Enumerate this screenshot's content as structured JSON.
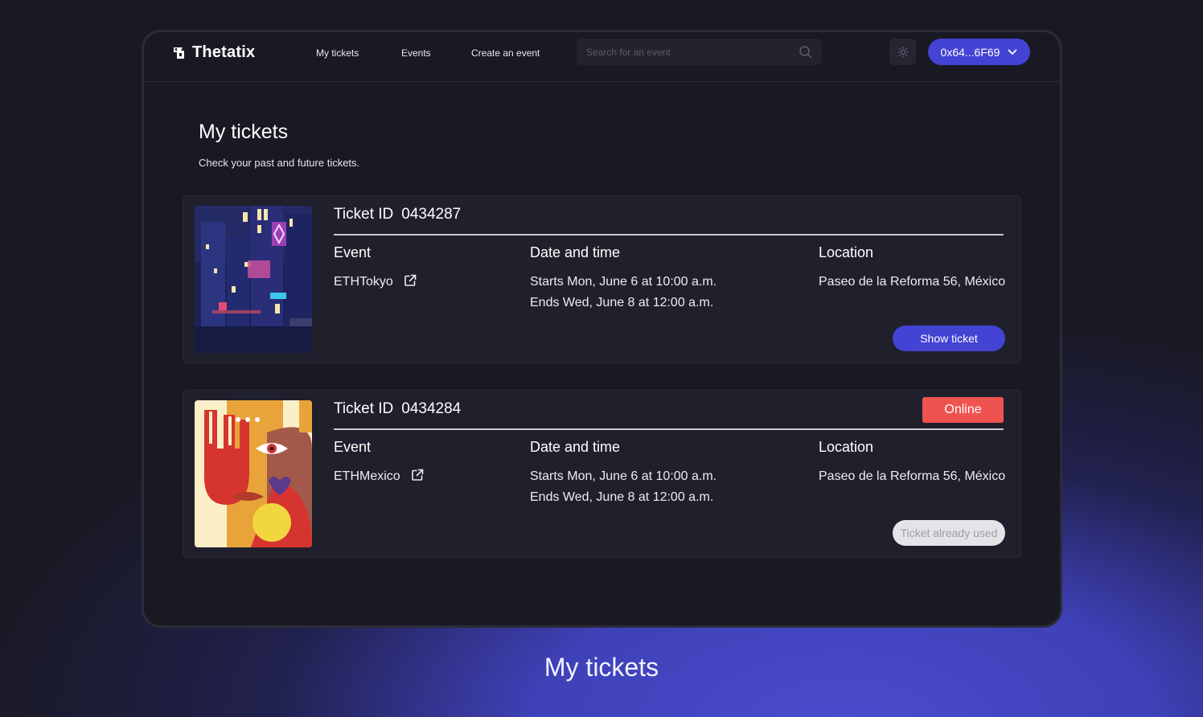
{
  "app": {
    "brand": "Thetatix"
  },
  "nav": {
    "links": [
      "My tickets",
      "Events",
      "Create an event"
    ],
    "search_placeholder": "Search for an event",
    "wallet_address": "0x64...6F69"
  },
  "page": {
    "title": "My tickets",
    "subtitle": "Check your past and future tickets."
  },
  "tickets": [
    {
      "id_label": "Ticket ID",
      "id": "0434287",
      "event_header": "Event",
      "event_name": "ETHTokyo",
      "date_header": "Date and time",
      "starts": "Starts Mon, June 6 at 10:00 a.m.",
      "ends": "Ends Wed, June 8 at 12:00 a.m.",
      "location_header": "Location",
      "location": "Paseo de la Reforma 56, México",
      "action_label": "Show ticket"
    },
    {
      "id_label": "Ticket ID",
      "id": "0434284",
      "badge": "Online",
      "event_header": "Event",
      "event_name": "ETHMexico",
      "date_header": "Date and time",
      "starts": "Starts Mon, June 6 at 10:00 a.m.",
      "ends": "Ends Wed, June 8 at 12:00 a.m.",
      "location_header": "Location",
      "location": "Paseo de la Reforma 56, México",
      "action_label": "Ticket already used"
    }
  ],
  "caption": "My tickets",
  "colors": {
    "background": "#191923",
    "card": "#20202c",
    "accent": "#4343d4",
    "online_badge": "#ef5350",
    "disabled_button": "#e4e4e8"
  },
  "icons": [
    "thetatix-logo-icon",
    "search-icon",
    "sun-icon",
    "chevron-down-icon",
    "external-link-icon"
  ]
}
